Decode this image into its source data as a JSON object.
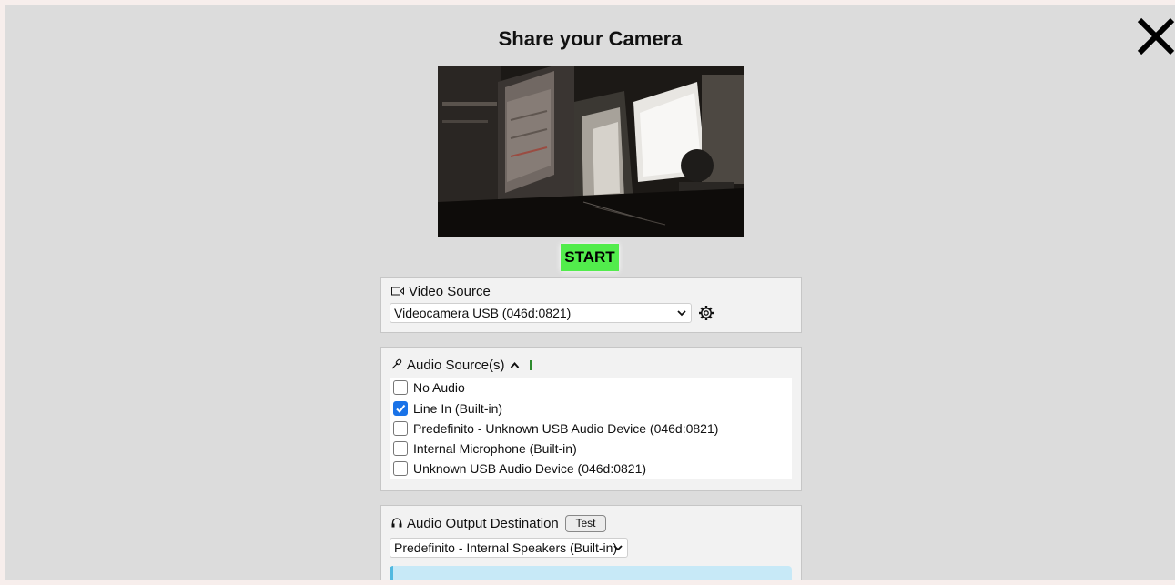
{
  "dialog": {
    "title": "Share your Camera",
    "close_icon": "close-icon",
    "start_label": "START",
    "start_color": "#52ec4c"
  },
  "video": {
    "header": "Video Source",
    "icon": "video-camera-icon",
    "selected": "Videocamera USB (046d:0821)",
    "settings_icon": "gear-icon"
  },
  "audio": {
    "header": "Audio Source(s)",
    "icon": "microphone-icon",
    "toggle_icon": "chevron-up-icon",
    "level_color": "#2e8b2e",
    "options": [
      {
        "label": "No Audio",
        "checked": false
      },
      {
        "label": "Line In (Built-in)",
        "checked": true
      },
      {
        "label": "Predefinito - Unknown USB Audio Device (046d:0821)",
        "checked": false
      },
      {
        "label": "Internal Microphone (Built-in)",
        "checked": false
      },
      {
        "label": "Unknown USB Audio Device (046d:0821)",
        "checked": false
      }
    ]
  },
  "output": {
    "header": "Audio Output Destination",
    "icon": "headphones-icon",
    "test_label": "Test",
    "selected": "Predefinito - Internal Speakers (Built-in)"
  }
}
